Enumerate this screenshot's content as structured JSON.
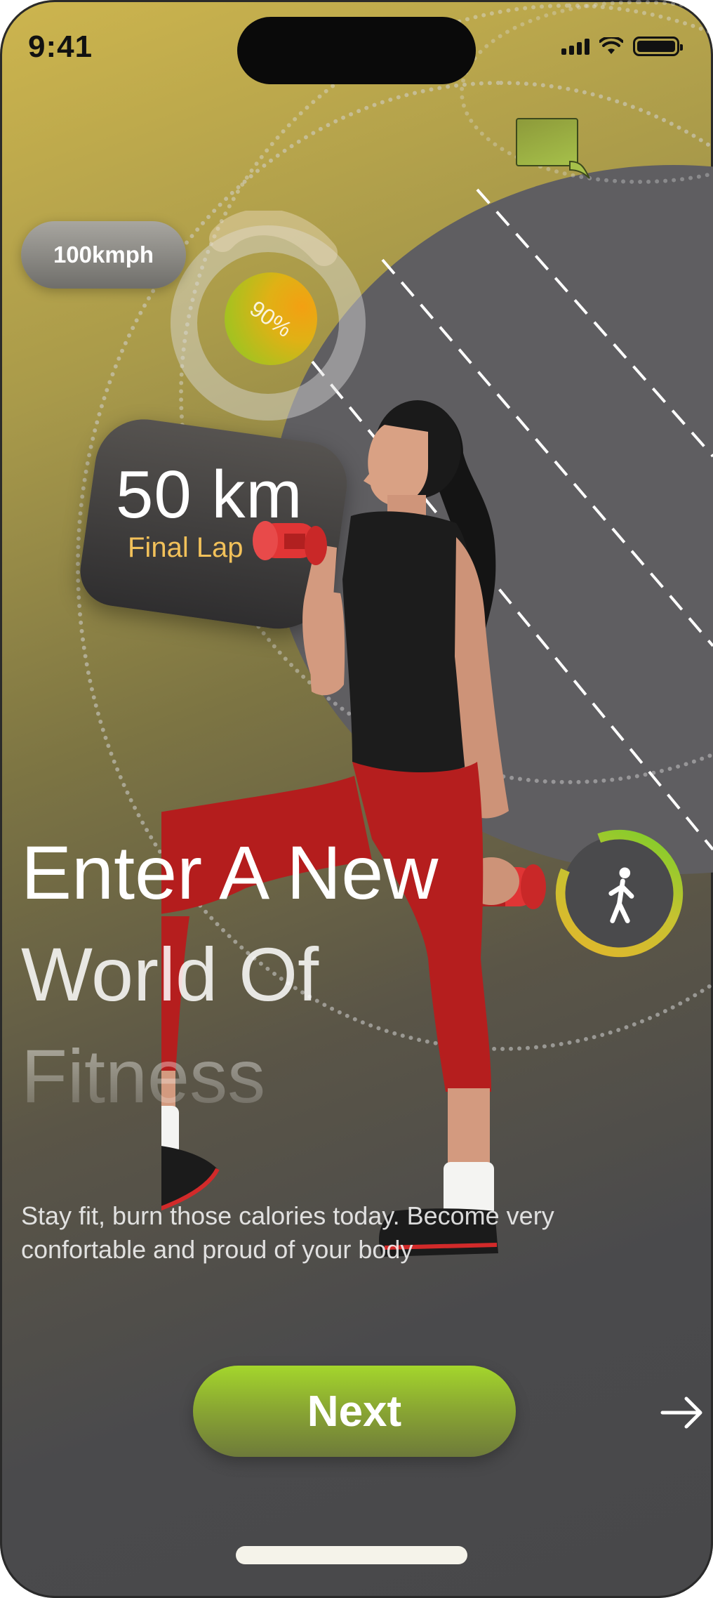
{
  "status_bar": {
    "time": "9:41"
  },
  "stats": {
    "speed": "100kmph",
    "progress_label": "90%",
    "progress_value": 0.9,
    "distance": "50 km",
    "lap_label": "Final Lap"
  },
  "hero": {
    "headline_line1": "Enter A New",
    "headline_line2": "World Of",
    "headline_line3": "Fitness",
    "subtitle": "Stay fit, burn those calories today. Become very confortable and proud of  your body"
  },
  "actions": {
    "next_label": "Next",
    "arrow_icon": "arrow-right-icon"
  },
  "colors": {
    "accent_green": "#9fd12d",
    "lap_label_color": "#f2c15a",
    "progress_orange": "#f3a012"
  }
}
